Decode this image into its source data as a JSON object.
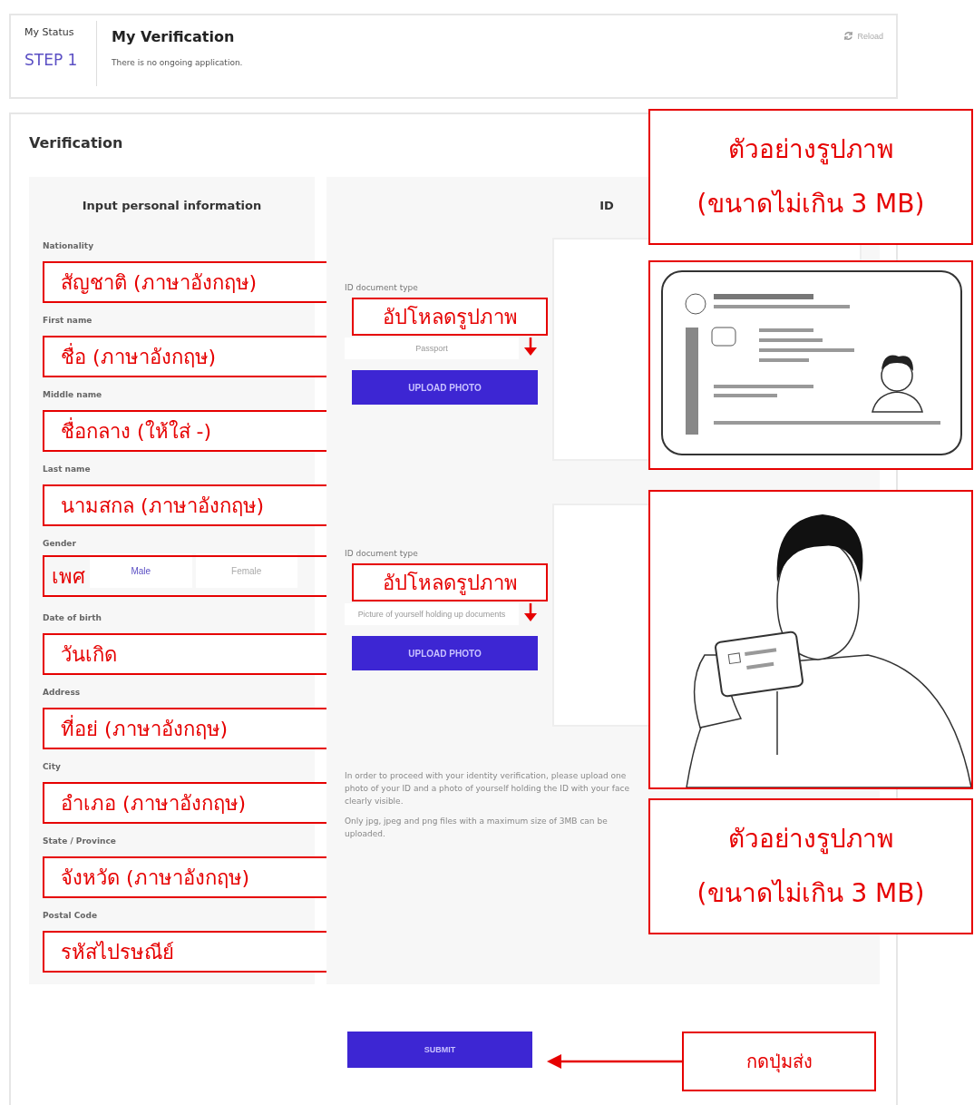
{
  "status": {
    "label": "My Status",
    "step": "STEP 1"
  },
  "header": {
    "title": "My Verification",
    "message": "There is no ongoing application.",
    "reload": "Reload"
  },
  "section_title": "Verification",
  "personal": {
    "title": "Input personal information",
    "fields": [
      {
        "label": "Nationality",
        "kind": "text",
        "annotation": "สัญชาติ (ภาษาอังกฤษ)"
      },
      {
        "label": "First name",
        "kind": "text",
        "annotation": "ชื่อ (ภาษาอังกฤษ)"
      },
      {
        "label": "Middle name",
        "kind": "text",
        "annotation": "ชื่อกลาง (ให้ใส่ -)"
      },
      {
        "label": "Last name",
        "kind": "text",
        "annotation": "นามสกล (ภาษาอังกฤษ)"
      },
      {
        "label": "Gender",
        "kind": "toggle",
        "annotation": "เพศ",
        "options": [
          {
            "label": "Male",
            "selected": true
          },
          {
            "label": "Female",
            "selected": false
          }
        ]
      },
      {
        "label": "Date of birth",
        "kind": "text",
        "annotation": "วันเกิด"
      },
      {
        "label": "Address",
        "kind": "text",
        "annotation": "ที่อย่ (ภาษาอังกฤษ)"
      },
      {
        "label": "City",
        "kind": "text",
        "annotation": "อำเภอ (ภาษาอังกฤษ)"
      },
      {
        "label": "State / Province",
        "kind": "text",
        "annotation": "จังหวัด (ภาษาอังกฤษ)"
      },
      {
        "label": "Postal Code",
        "kind": "text",
        "annotation": "รหัสไปรษณีย์"
      }
    ]
  },
  "id_panel": {
    "title": "ID",
    "uploads": [
      {
        "label": "ID document type",
        "value": "Passport",
        "button": "UPLOAD PHOTO",
        "annotation": "อัปโหลดรูปภาพ"
      },
      {
        "label": "ID document type",
        "value": "Picture of yourself holding up documents",
        "button": "UPLOAD PHOTO",
        "annotation": "อัปโหลดรูปภาพ"
      }
    ],
    "notes": [
      "In order to proceed with your identity verification, please upload one photo of your ID and a photo of yourself holding the ID with your face clearly visible.",
      "Only jpg, jpeg and png files with a maximum size of 3MB can be uploaded."
    ]
  },
  "examples": [
    {
      "kind": "caption",
      "text": "ตัวอย่างรูปภาพ (ขนาดไม่เกิน 3 MB)"
    },
    {
      "kind": "picture"
    },
    {
      "kind": "picture"
    },
    {
      "kind": "caption",
      "text": "ตัวอย่างรูปภาพ (ขนาดไม่เกิน 3 MB)"
    }
  ],
  "submit": {
    "button": "SUBMIT",
    "annotation": "กดปุ่มส่ง"
  }
}
